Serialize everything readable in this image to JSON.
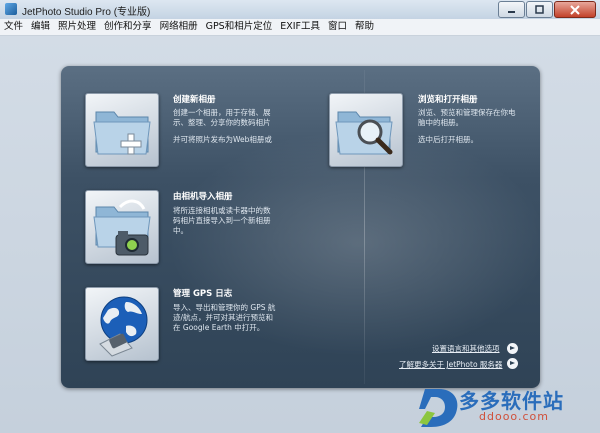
{
  "window": {
    "title": "JetPhoto Studio Pro (专业版)",
    "buttons": [
      "minimize",
      "maximize",
      "close"
    ]
  },
  "menu": {
    "items": [
      "文件",
      "编辑",
      "照片处理",
      "创作和分享",
      "网络相册",
      "GPS和相片定位",
      "EXIF工具",
      "窗口",
      "帮助"
    ]
  },
  "actions": [
    {
      "title": "创建新相册",
      "icon": "folder-plus-icon",
      "description": [
        "创建一个相册，用于存储、展",
        "示、整理、分享你的数码相片",
        "",
        "并可将照片发布为Web相册或"
      ]
    },
    {
      "title": "由相机导入相册",
      "icon": "folder-camera-icon",
      "description": [
        "将所连接相机或读卡器中的数",
        "码相片直接导入到一个新相册",
        "中。"
      ]
    },
    {
      "title": "管理 GPS 日志",
      "icon": "globe-gps-icon",
      "description": [
        "导入、导出和管理你的 GPS 航",
        "迹/航点，并可对其进行预览和",
        "在 Google Earth 中打开。"
      ]
    },
    {
      "title": "浏览和打开相册",
      "icon": "folder-magnifier-icon",
      "description": [
        "浏览、预览和管理保存在你电",
        "脑中的相册。",
        "",
        "选中后打开相册。"
      ]
    }
  ],
  "footer_links": [
    {
      "label": "设置语言和其他选项"
    },
    {
      "label": "了解更多关于 JetPhoto 服务器"
    }
  ],
  "watermark": {
    "text": "多多软件站",
    "url": "ddooo.com",
    "logo_letter": "D"
  }
}
